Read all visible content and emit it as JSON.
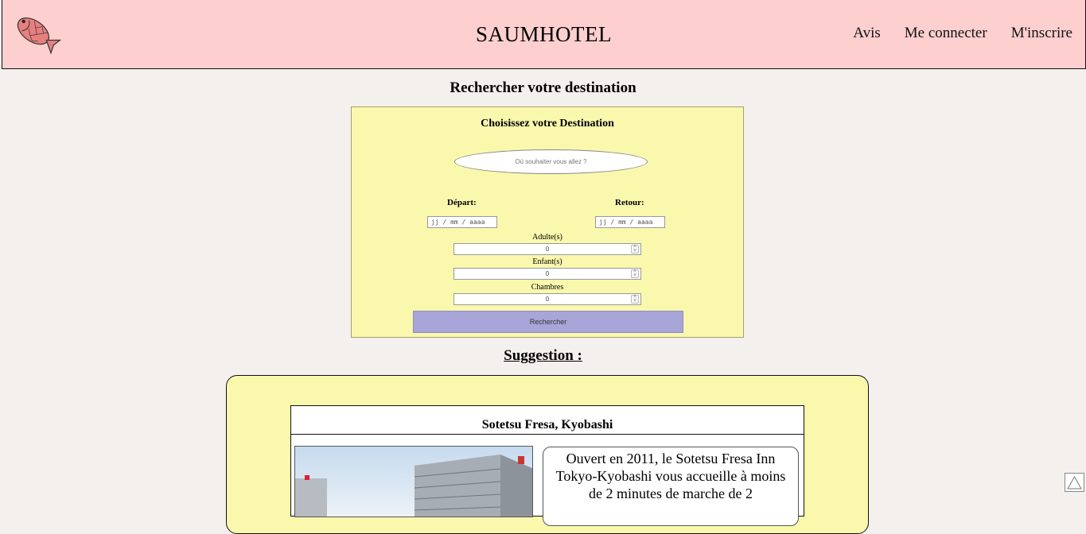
{
  "header": {
    "site_title": "SAUMHOTEL",
    "logo_icon": "fish-logo-icon",
    "nav": [
      {
        "label": "Avis"
      },
      {
        "label": "Me connecter"
      },
      {
        "label": "M'inscrire"
      }
    ]
  },
  "search": {
    "heading": "Rechercher votre destination",
    "box_title": "Choisissez votre Destination",
    "destination_placeholder": "Où souhaiter vous allez ?",
    "depart_label": "Départ:",
    "retour_label": "Retour:",
    "depart_placeholder": "jj / mm / aaaa",
    "retour_placeholder": "jj / mm / aaaa",
    "adults_label": "Adulte(s)",
    "adults_value": "0",
    "children_label": "Enfant(s)",
    "children_value": "0",
    "rooms_label": "Chambres",
    "rooms_value": "0",
    "submit_label": "Rechercher"
  },
  "suggestion": {
    "heading": "Suggestion :",
    "hotel": {
      "name": "Sotetsu Fresa, Kyobashi",
      "description": "Ouvert en 2011, le Sotetsu Fresa Inn Tokyo-Kyobashi vous accueille à moins de 2 minutes de marche de 2"
    }
  },
  "colors": {
    "header_bg": "#fdcfcf",
    "panel_bg": "#f9f8ad",
    "button_bg": "#a8a5d9",
    "page_bg": "#f4f0ee"
  }
}
